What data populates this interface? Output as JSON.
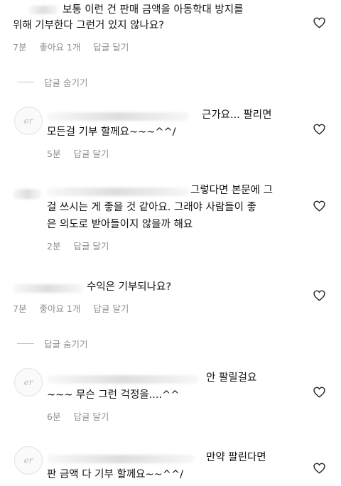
{
  "comments": [
    {
      "id": "c1",
      "lines": [
        "보통 이런 건 판매 금액을 아동학대 방지를",
        "위해 기부한다 그런거 있지 않나요?"
      ],
      "time": "7분",
      "likes": "좋아요 1개",
      "reply": "답글 달기"
    },
    {
      "id": "c2",
      "lines": [
        "근가요... 팔리면",
        "모든걸 기부 할께요~~~^^/"
      ],
      "time": "5분",
      "reply": "답글 달기"
    },
    {
      "id": "c3",
      "lines": [
        "그렇다면 본문에 그",
        "걸 쓰시는 게 좋을 것 같아요. 그래야 사람들이 좋",
        "은 의도로 받아들이지 않을까 해요"
      ],
      "time": "2분",
      "reply": "답글 달기"
    },
    {
      "id": "c4",
      "lines": [
        "수익은 기부되나요?"
      ],
      "time": "7분",
      "likes": "좋아요 1개",
      "reply": "답글 달기"
    },
    {
      "id": "c5",
      "lines": [
        "안 팔릴걸요",
        "~~~ 무슨 그런 걱정을....^^"
      ],
      "time": "6분",
      "reply": "답글 달기"
    },
    {
      "id": "c6",
      "lines": [
        "만약 팔린다면",
        "판 금액 다 기부 할께요~~^^/"
      ]
    }
  ],
  "hide_replies_label": "답글 숨기기",
  "icons": {
    "heart": "heart-outline-icon",
    "avatar": "default-avatar-icon"
  },
  "colors": {
    "text": "#111111",
    "meta": "#8e8e8e",
    "heart": "#262626"
  }
}
